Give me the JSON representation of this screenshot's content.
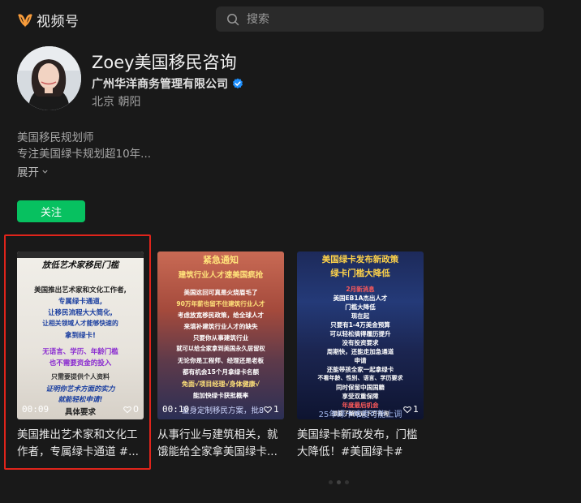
{
  "app": {
    "name": "视频号",
    "brand_color": "#fa9d3b"
  },
  "search": {
    "placeholder": "搜索"
  },
  "profile": {
    "name": "Zoey美国移民咨询",
    "company": "广州华洋商务管理有限公司",
    "location": "北京 朝阳",
    "bio_line1": "美国移民规划师",
    "bio_line2": "专注美国绿卡规划超10年...",
    "expand_label": "展开",
    "follow_label": "关注",
    "follow_color": "#07c160",
    "verified_color": "#1e90ff"
  },
  "videos": [
    {
      "title": "美国推出艺术家和文化工作者，专属绿卡通道 #...",
      "duration": "00:09",
      "likes": "0",
      "thumb_lines": [
        "放低艺术家移民门槛",
        "美国推出艺术家和文化工作者,",
        "专属绿卡通道,",
        "让移民流程大大简化,",
        "让相关领域人才能够快速的",
        "拿到绿卡!",
        "无语言、学历、年龄门槛",
        "也不需要资金的投入",
        "只需要提供个人资料",
        "证明你艺术方面的实力",
        "就能轻松申请!",
        "具体要求"
      ]
    },
    {
      "title": "从事行业与建筑相关，就饿能给全家拿美国绿卡...",
      "duration": "00:10",
      "likes": "1",
      "caption": "量身定制移民方案，批8",
      "thumb_lines": [
        "紧急通知",
        "建筑行业人才速美国疯抢",
        "美国这回可真是火烧眉毛了",
        "90万年薪也留不住建筑行业人才",
        "考虑放宽移民政策，给全球人才",
        "来填补建筑行业人才的缺失",
        "只要你从事建筑行业",
        "就可以给全家拿到美国永久居留权",
        "无论你是工程师、经理还是老板",
        "都有机会15个月拿绿卡名额",
        "免面√项目经理√身体健康√",
        "能加快绿卡获批概率"
      ]
    },
    {
      "title": "美国绿卡新政发布，门槛大降低！#美国绿卡#美...",
      "duration": "",
      "likes": "1",
      "caption": "25年绿卡难度可能上调",
      "thumb_lines": [
        "美国绿卡发布新政策",
        "绿卡门槛大降低",
        "2月新消息",
        "美国EB1A杰出人才",
        "门槛大降低",
        "现在起",
        "只要有1-4万美金预算",
        "可以轻松搞得履历提升",
        "没有投资要求",
        "周期快，还能走加急通道",
        "申请",
        "还能带孩全家一起拿绿卡",
        "不看年龄、性别、语言、学历要求",
        "同时保留中国国籍",
        "享受双重保障",
        "年度最后机会",
        "想要了解欢迎下方咨询"
      ]
    }
  ]
}
